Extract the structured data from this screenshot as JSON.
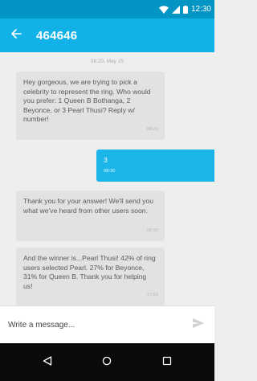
{
  "status_bar": {
    "time": "12:30"
  },
  "app_bar": {
    "title": "464646"
  },
  "thread": {
    "date_separator": "08:20, May 25",
    "messages": [
      {
        "direction": "incoming",
        "text": "Hey gorgeous, we are trying to pick a celebrity to represent the ring. Who would you prefer: 1 Queen B Bothanga, 2 Beyonce, or 3 Pearl Thusi? Reply w/ number!",
        "time": "08:20"
      },
      {
        "direction": "outgoing",
        "text": "3",
        "time": "08:30"
      },
      {
        "direction": "incoming",
        "text": "Thank you for your answer! We'll send you what we've heard from other users soon.",
        "time": "08:32"
      },
      {
        "direction": "incoming",
        "text": "And the winner is...Pearl Thusi! 42% of ring users selected Pearl. 27% for Beyonce, 31% for Queen B. Thank you for helping us!",
        "time": "17:53"
      }
    ]
  },
  "composer": {
    "placeholder": "Write a message..."
  },
  "icons": {
    "back": "arrow-back-icon",
    "send": "send-icon",
    "nav_back": "triangle-back-icon",
    "nav_home": "circle-home-icon",
    "nav_recent": "square-recent-icon"
  },
  "colors": {
    "status_bar": "#0396c4",
    "app_bar": "#12b1e8",
    "outgoing_bubble": "#1cb5ea",
    "incoming_bubble": "#e2e2e2"
  }
}
